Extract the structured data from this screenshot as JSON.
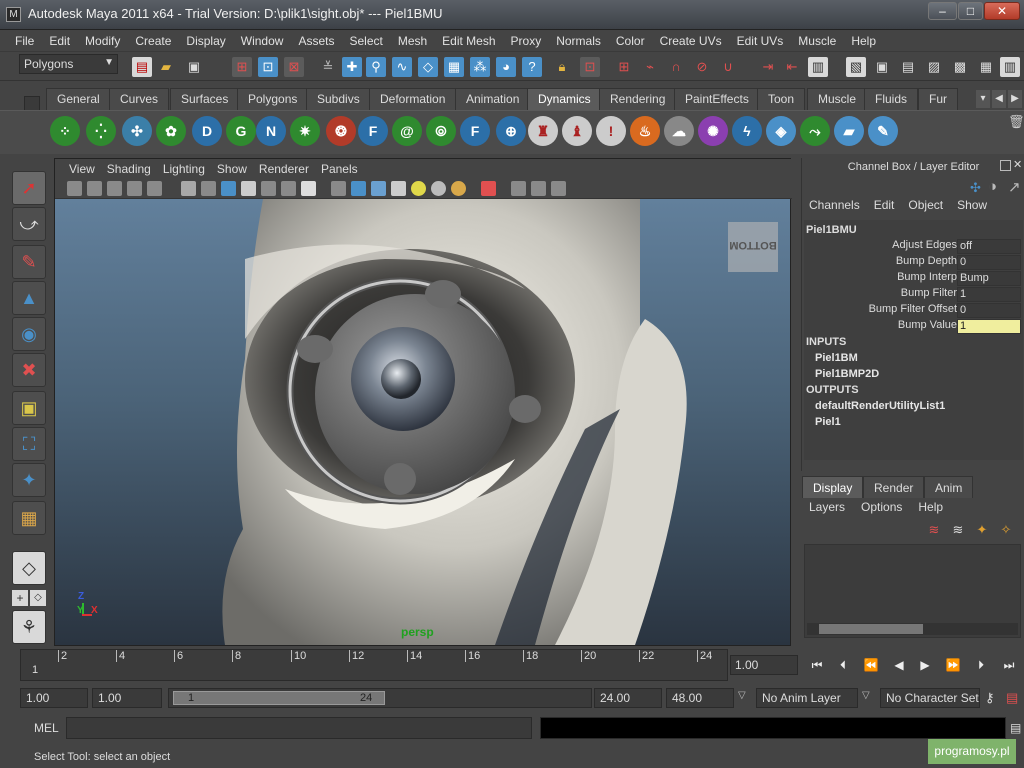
{
  "window": {
    "title": "Autodesk Maya 2011 x64 - Trial Version: D:\\plik1\\sight.obj*   ---   Piel1BMU",
    "minimize": "–",
    "maximize": "□",
    "close": "✕"
  },
  "menubar": [
    "File",
    "Edit",
    "Modify",
    "Create",
    "Display",
    "Window",
    "Assets",
    "Select",
    "Mesh",
    "Edit Mesh",
    "Proxy",
    "Normals",
    "Color",
    "Create UVs",
    "Edit UVs",
    "Muscle",
    "Help"
  ],
  "statusline": {
    "mode": "Polygons"
  },
  "shelf": {
    "tabs": [
      "General",
      "Curves",
      "Surfaces",
      "Polygons",
      "Subdivs",
      "Deformation",
      "Animation",
      "Dynamics",
      "Rendering",
      "PaintEffects",
      "Toon",
      "Muscle",
      "Fluids",
      "Fur"
    ],
    "active_tab": "Dynamics",
    "icons": [
      "particle-tool",
      "emitter",
      "omni-emitter",
      "air-field",
      "drag",
      "gravity",
      "newton",
      "radial",
      "turbulence",
      "uniform",
      "vortex",
      "volume-axis",
      "collide",
      "rigid-body",
      "constraint",
      "fire",
      "smoke",
      "fireworks",
      "lightning",
      "shatter",
      "curve-flow",
      "surface-flow",
      "delete-rigid"
    ],
    "icon_letters": {
      "drag": "D",
      "gravity": "G",
      "newton": "N",
      "uniform": "F",
      "volume-axis": "F"
    }
  },
  "viewport": {
    "menu": [
      "View",
      "Shading",
      "Lighting",
      "Show",
      "Renderer",
      "Panels"
    ],
    "camera": "persp",
    "bottom_label": "BOTTOM",
    "axis": {
      "x": "X",
      "y": "Y",
      "z": "Z"
    }
  },
  "channel_box": {
    "title": "Channel Box / Layer Editor",
    "menu": [
      "Channels",
      "Edit",
      "Object",
      "Show"
    ],
    "node": "Piel1BMU",
    "attributes": [
      {
        "label": "Adjust Edges",
        "value": "off"
      },
      {
        "label": "Bump Depth",
        "value": "0"
      },
      {
        "label": "Bump Interp",
        "value": "Bump"
      },
      {
        "label": "Bump Filter",
        "value": "1"
      },
      {
        "label": "Bump Filter Offset",
        "value": "0"
      },
      {
        "label": "Bump Value",
        "value": "1"
      }
    ],
    "inputs_header": "INPUTS",
    "inputs": [
      "Piel1BM",
      "Piel1BMP2D"
    ],
    "outputs_header": "OUTPUTS",
    "outputs": [
      "defaultRenderUtilityList1",
      "Piel1"
    ]
  },
  "layer_editor": {
    "tabs": [
      "Display",
      "Render",
      "Anim"
    ],
    "active_tab": "Display",
    "menu": [
      "Layers",
      "Options",
      "Help"
    ]
  },
  "timeline": {
    "start_label": "1",
    "ticks": [
      "2",
      "4",
      "6",
      "8",
      "10",
      "12",
      "14",
      "16",
      "18",
      "20",
      "22",
      "24"
    ],
    "current_frame": "1.00"
  },
  "range": {
    "start": "1.00",
    "anim_start": "1.00",
    "range_start_label": "1",
    "range_end_label": "24",
    "range_end": "24.00",
    "anim_end": "48.00",
    "anim_layer": "No Anim Layer",
    "character_set": "No Character Set"
  },
  "command": {
    "label": "MEL"
  },
  "helpline": "Select Tool: select an object",
  "watermark": "programosy.pl"
}
